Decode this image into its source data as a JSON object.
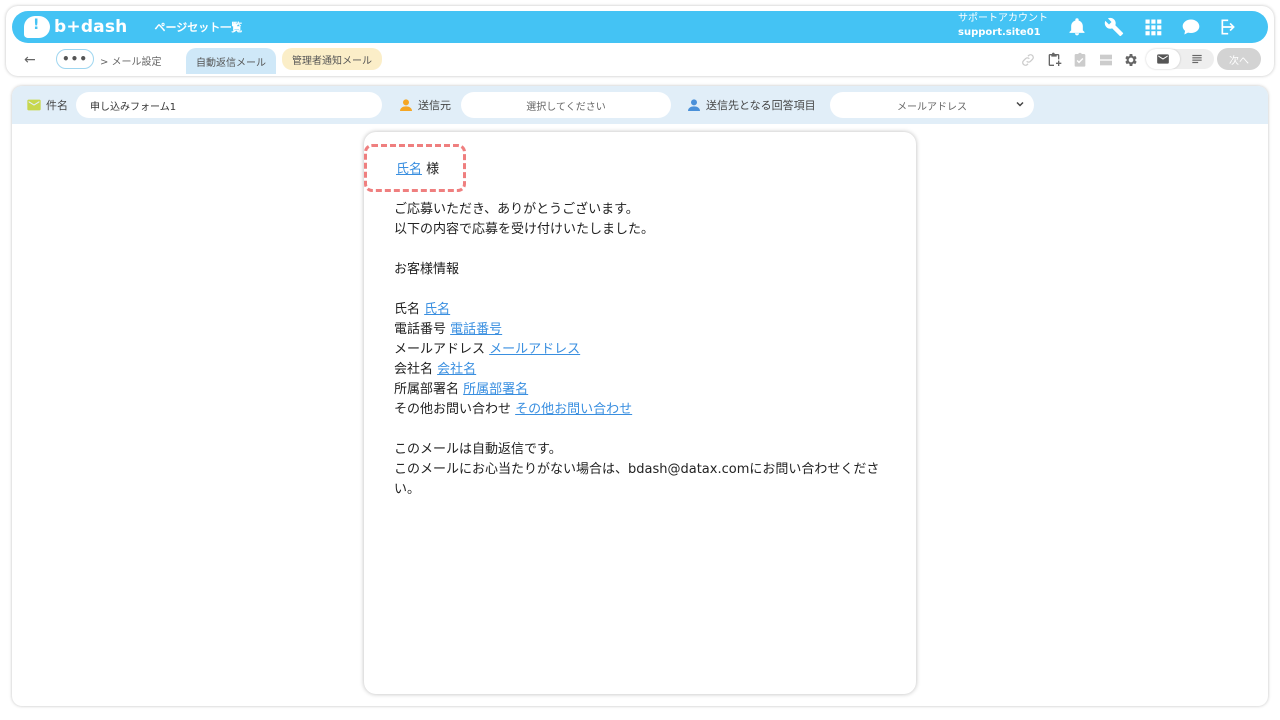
{
  "header": {
    "logo_text": "b+dash",
    "page_set_title": "ページセット一覧",
    "account_label": "サポートアカウント",
    "account_id": "support.site01",
    "icons": [
      "bell-icon",
      "wrench-icon",
      "grid-icon",
      "chat-icon",
      "logout-icon"
    ]
  },
  "subbar": {
    "back_icon": "←",
    "more_label": "•••",
    "breadcrumb": "> メール設定",
    "tabs": [
      {
        "label": "自動返信メール",
        "active": true
      },
      {
        "label": "管理者通知メール",
        "active": false
      }
    ],
    "next_label": "次へ"
  },
  "fields": {
    "subject_label": "件名",
    "subject_value": "申し込みフォーム1",
    "sender_label": "送信元",
    "sender_placeholder": "選択してください",
    "recipient_label": "送信先となる回答項目",
    "recipient_value": "メールアドレス"
  },
  "email": {
    "greeting_var": "氏名",
    "greeting_suffix": "様",
    "line1": "ご応募いただき、ありがとうございます。",
    "line2": "以下の内容で応募を受け付けいたしました。",
    "section_title": "お客様情報",
    "rows": [
      {
        "label": "氏名",
        "var": "氏名"
      },
      {
        "label": "電話番号",
        "var": "電話番号"
      },
      {
        "label": "メールアドレス",
        "var": "メールアドレス"
      },
      {
        "label": "会社名",
        "var": "会社名"
      },
      {
        "label": "所属部署名",
        "var": "所属部署名"
      },
      {
        "label": "その他お問い合わせ",
        "var": "その他お問い合わせ"
      }
    ],
    "footer1": "このメールは自動返信です。",
    "footer2": "このメールにお心当たりがない場合は、bdash@datax.comにお問い合わせください。"
  },
  "colors": {
    "accent": "#44c3f4",
    "field_bar": "#e1eef8",
    "variable_link": "#3a8fe0",
    "highlight": "#ef7f7f",
    "tab_admin": "#fbeec8"
  }
}
